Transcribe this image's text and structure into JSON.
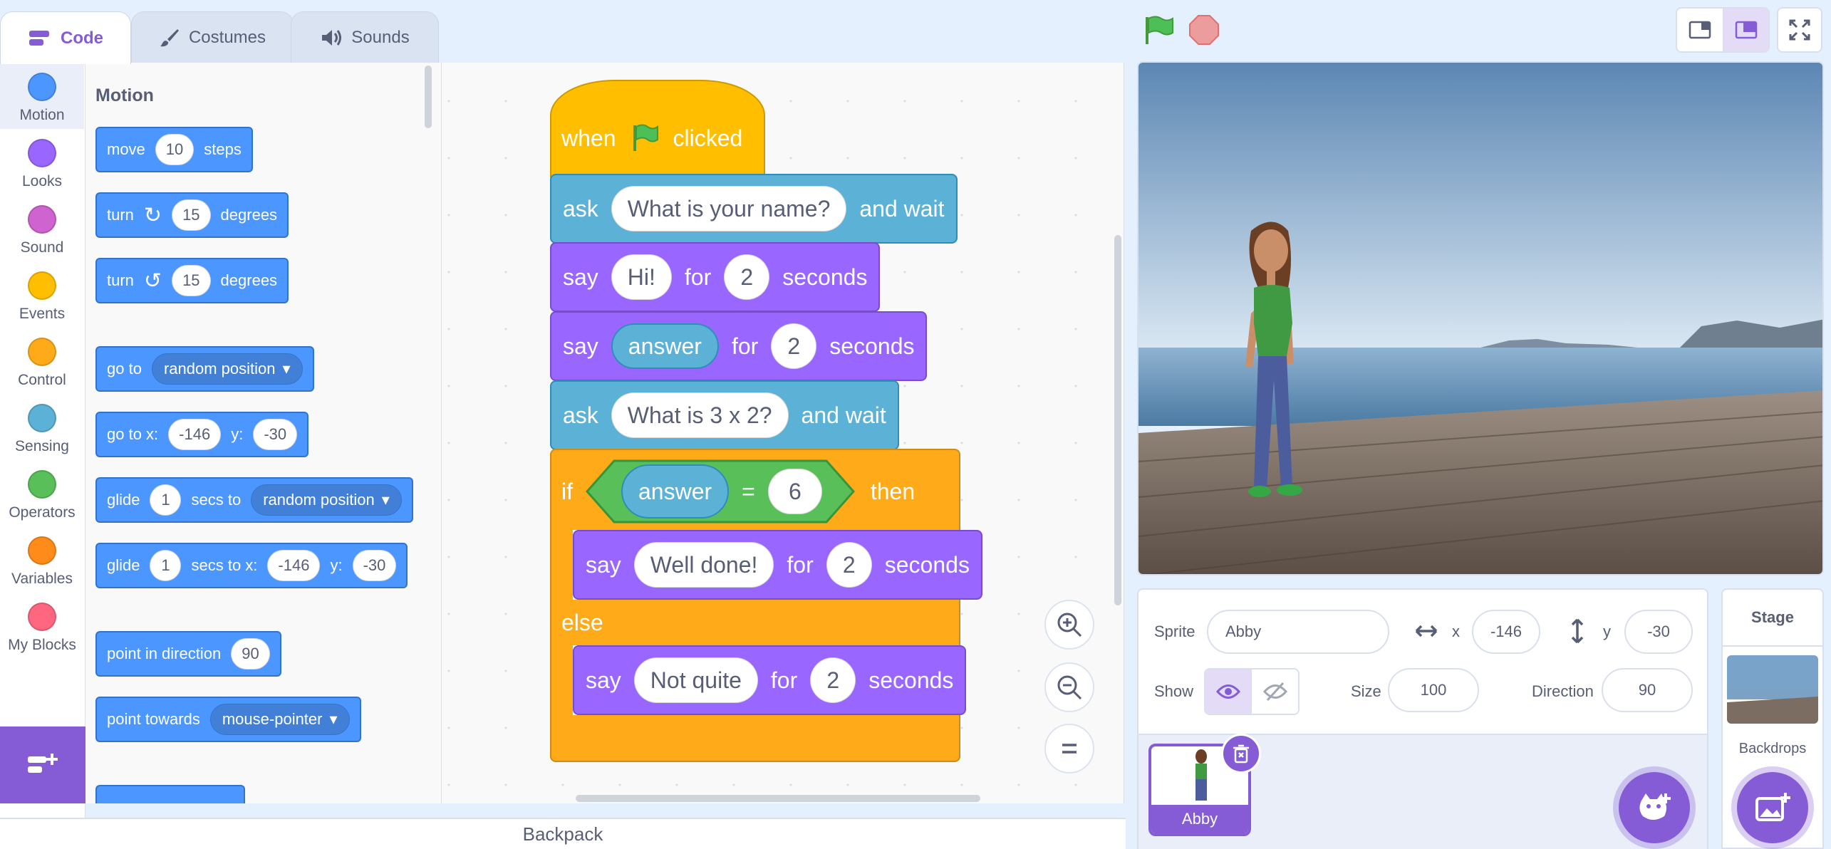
{
  "tabs": {
    "code": "Code",
    "costumes": "Costumes",
    "sounds": "Sounds"
  },
  "categories": [
    {
      "label": "Motion",
      "color": "#4c97ff"
    },
    {
      "label": "Looks",
      "color": "#9966ff"
    },
    {
      "label": "Sound",
      "color": "#cf63cf"
    },
    {
      "label": "Events",
      "color": "#ffbf00"
    },
    {
      "label": "Control",
      "color": "#ffab19"
    },
    {
      "label": "Sensing",
      "color": "#5cb1d6"
    },
    {
      "label": "Operators",
      "color": "#59c059"
    },
    {
      "label": "Variables",
      "color": "#ff8c1a"
    },
    {
      "label": "My Blocks",
      "color": "#ff6680"
    }
  ],
  "palette": {
    "heading": "Motion",
    "move": {
      "a": "move",
      "v": "10",
      "b": "steps"
    },
    "turn_right": {
      "a": "turn",
      "v": "15",
      "b": "degrees"
    },
    "turn_left": {
      "a": "turn",
      "v": "15",
      "b": "degrees"
    },
    "goto": {
      "a": "go to",
      "opt": "random position"
    },
    "gotoxy": {
      "a": "go to x:",
      "x": "-146",
      "b": "y:",
      "y": "-30"
    },
    "glide": {
      "a": "glide",
      "v": "1",
      "b": "secs to",
      "opt": "random position"
    },
    "glidexy": {
      "a": "glide",
      "v": "1",
      "b": "secs to x:",
      "x": "-146",
      "c": "y:",
      "y": "-30"
    },
    "point_dir": {
      "a": "point in direction",
      "v": "90"
    },
    "point_towards": {
      "a": "point towards",
      "opt": "mouse-pointer"
    }
  },
  "script": {
    "hat": {
      "a": "when",
      "b": "clicked"
    },
    "ask1": {
      "a": "ask",
      "v": "What is your name?",
      "b": "and wait"
    },
    "say1": {
      "a": "say",
      "v": "Hi!",
      "b": "for",
      "n": "2",
      "c": "seconds"
    },
    "say2": {
      "a": "say",
      "v": "answer",
      "b": "for",
      "n": "2",
      "c": "seconds"
    },
    "ask2": {
      "a": "ask",
      "v": "What is 3 x 2?",
      "b": "and wait"
    },
    "if": {
      "a": "if",
      "rep": "answer",
      "op": "=",
      "val": "6",
      "b": "then",
      "else": "else"
    },
    "say3": {
      "a": "say",
      "v": "Well done!",
      "b": "for",
      "n": "2",
      "c": "seconds"
    },
    "say4": {
      "a": "say",
      "v": "Not quite",
      "b": "for",
      "n": "2",
      "c": "seconds"
    }
  },
  "backpack": "Backpack",
  "sprite_info": {
    "sprite_label": "Sprite",
    "sprite_name": "Abby",
    "x_label": "x",
    "x": "-146",
    "y_label": "y",
    "y": "-30",
    "show_label": "Show",
    "size_label": "Size",
    "size": "100",
    "direction_label": "Direction",
    "direction": "90"
  },
  "sprites": [
    {
      "name": "Abby"
    }
  ],
  "stage_pane": {
    "title": "Stage",
    "backdrops": "Backdrops"
  },
  "colors": {
    "accent": "#855cd6",
    "motion": "#4c97ff",
    "looks": "#9966ff",
    "control": "#ffab19",
    "sensing": "#5cb1d6",
    "operators": "#59c059"
  }
}
